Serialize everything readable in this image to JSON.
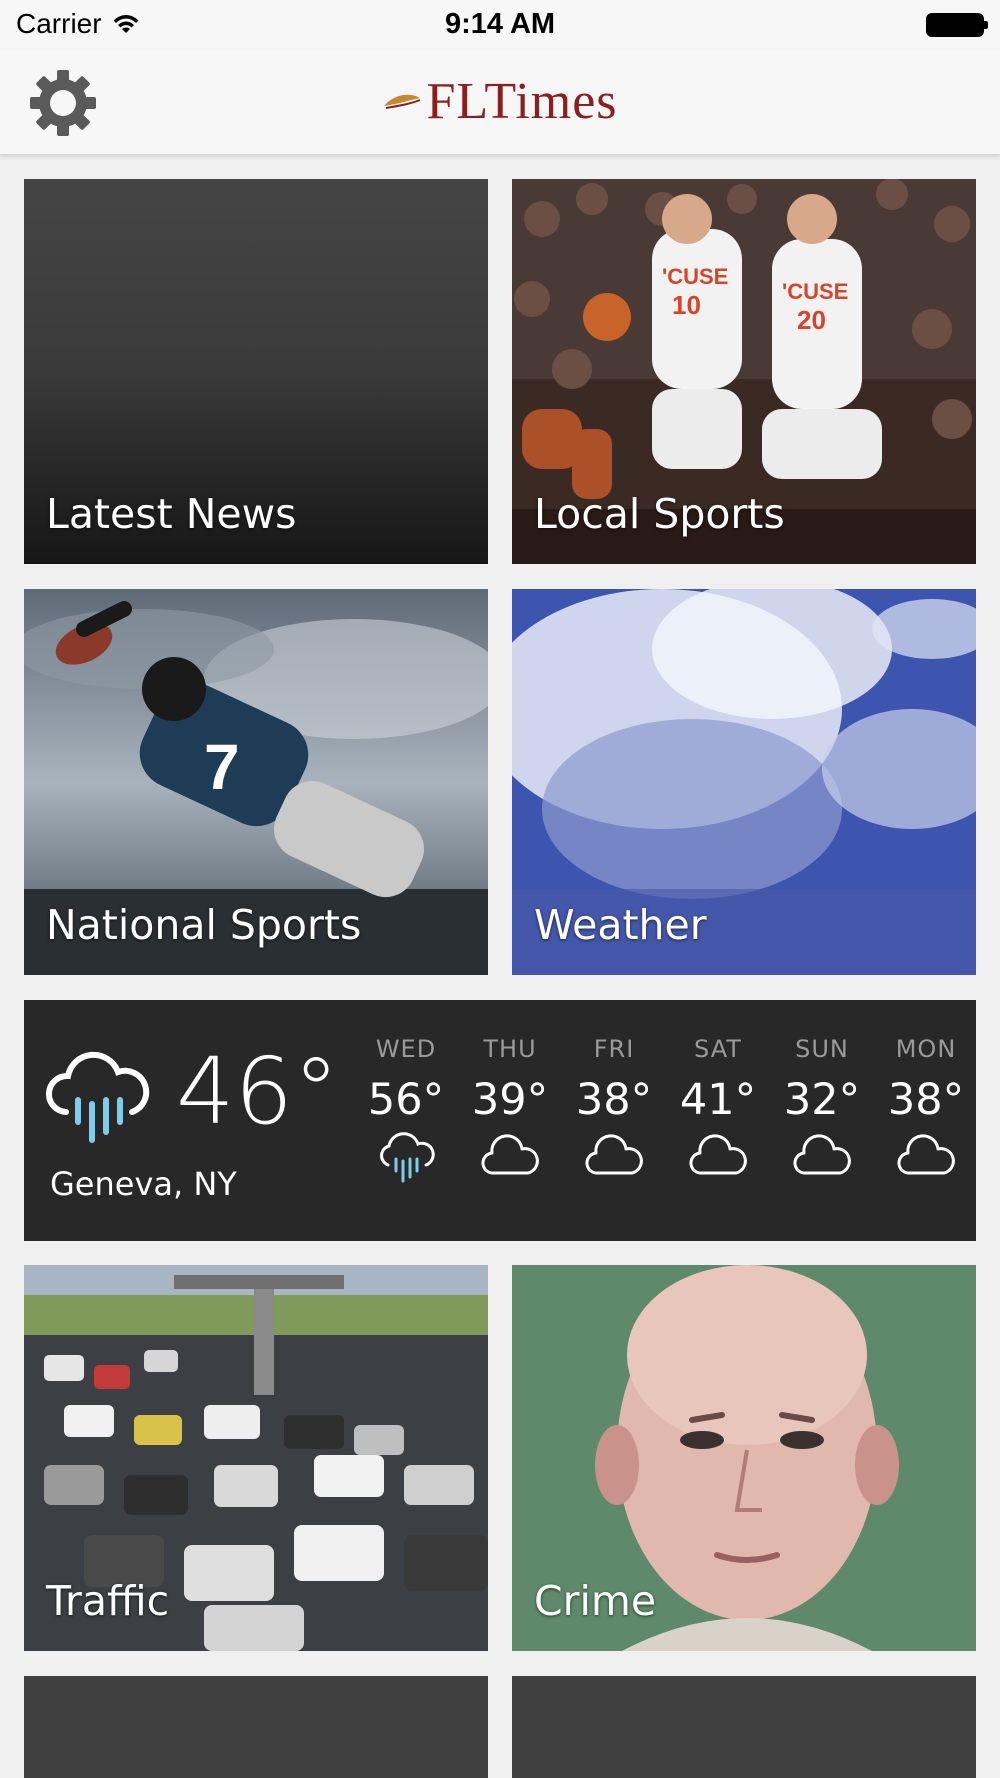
{
  "status_bar": {
    "carrier": "Carrier",
    "time": "9:14 AM"
  },
  "nav": {
    "logo_text": "FLTimes",
    "settings_icon": "gear-icon"
  },
  "tiles": [
    {
      "label": "Latest News"
    },
    {
      "label": "Local Sports"
    },
    {
      "label": "National Sports"
    },
    {
      "label": "Weather"
    },
    {
      "label": "Traffic"
    },
    {
      "label": "Crime"
    }
  ],
  "weather": {
    "current_temp": "46°",
    "location": "Geneva, NY",
    "current_icon": "rain-cloud-icon",
    "forecast": [
      {
        "day": "WED",
        "temp": "56°",
        "icon": "rain-cloud-icon"
      },
      {
        "day": "THU",
        "temp": "39°",
        "icon": "cloud-icon"
      },
      {
        "day": "FRI",
        "temp": "38°",
        "icon": "cloud-icon"
      },
      {
        "day": "SAT",
        "temp": "41°",
        "icon": "cloud-icon"
      },
      {
        "day": "SUN",
        "temp": "32°",
        "icon": "cloud-icon"
      },
      {
        "day": "MON",
        "temp": "38°",
        "icon": "cloud-icon"
      }
    ]
  },
  "colors": {
    "brand": "#8b1e1e",
    "rain_accent": "#7ecbea",
    "panel": "#282828"
  }
}
